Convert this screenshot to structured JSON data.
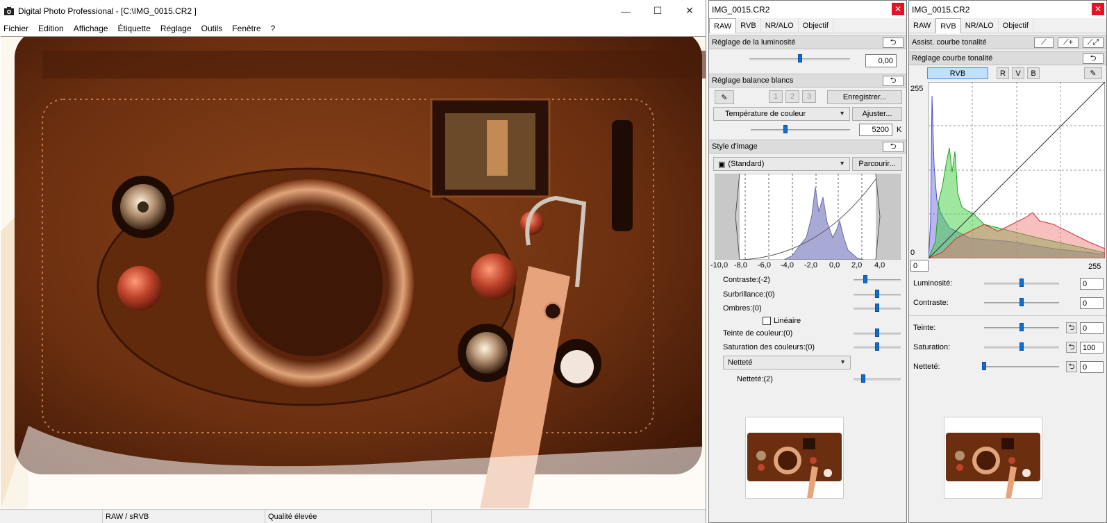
{
  "main": {
    "title": "Digital Photo Professional - [C:\\IMG_0015.CR2  ]",
    "menu": [
      "Fichier",
      "Edition",
      "Affichage",
      "Étiquette",
      "Réglage",
      "Outils",
      "Fenêtre",
      "?"
    ],
    "status": {
      "cell1": "",
      "cell2": "RAW / sRVB",
      "cell3": "Qualité élevée",
      "cell4": ""
    }
  },
  "left_panel": {
    "title": "IMG_0015.CR2",
    "tabs": [
      "RAW",
      "RVB",
      "NR/ALO",
      "Objectif"
    ],
    "active_tab": "RAW",
    "brightness": {
      "header": "Réglage de la luminosité",
      "value": "0,00",
      "slider_level": 0.5
    },
    "white_balance": {
      "header": "Réglage balance blancs",
      "presets": [
        "1",
        "2",
        "3"
      ],
      "register_label": "Enregistrer...",
      "mode": "Température de couleur",
      "adjust_label": "Ajuster...",
      "kelvin": "5200",
      "unit": "K",
      "slider_level": 0.35
    },
    "picture_style": {
      "header": "Style d'image",
      "style": "(Standard)",
      "browse_label": "Parcourir...",
      "axis_ticks": [
        "-10,0",
        "-8,0",
        "-6,0",
        "-4,0",
        "-2,0",
        "0,0",
        "2,0",
        "4,0"
      ],
      "contrast": {
        "label": "Contraste:(-2)",
        "level": 0.25
      },
      "highlight": {
        "label": "Surbrillance:(0)",
        "level": 0.5
      },
      "shadows": {
        "label": "Ombres:(0)",
        "level": 0.5
      },
      "linear_label": "Linéaire",
      "color_tone": {
        "label": "Teinte de couleur:(0)",
        "level": 0.5
      },
      "saturation": {
        "label": "Saturation des couleurs:(0)",
        "level": 0.5
      },
      "sharpness_mode": "Netteté",
      "sharpness": {
        "label": "Netteté:(2)",
        "level": 0.2
      }
    }
  },
  "right_panel": {
    "title": "IMG_0015.CR2",
    "tabs": [
      "RAW",
      "RVB",
      "NR/ALO",
      "Objectif"
    ],
    "active_tab": "RVB",
    "curve_assist_header": "Assist. courbe tonalité",
    "curve_adjust_header": "Réglage courbe tonalité",
    "channels": [
      "RVB",
      "R",
      "V",
      "B"
    ],
    "active_channel": "RVB",
    "axis": {
      "top": "255",
      "bottom_left": "0",
      "x_min": "0",
      "x_max": "255"
    },
    "brightness": {
      "label": "Luminosité:",
      "value": "0",
      "level": 0.5
    },
    "contrast": {
      "label": "Contraste:",
      "value": "0",
      "level": 0.5
    },
    "hue": {
      "label": "Teinte:",
      "value": "0",
      "level": 0.5
    },
    "saturation": {
      "label": "Saturation:",
      "value": "100",
      "level": 0.5
    },
    "sharpness": {
      "label": "Netteté:",
      "value": "0",
      "level": 0.0
    }
  },
  "colors": {
    "accent": "#0f6fd1",
    "close_red": "#e81123",
    "leather": "#7a3a14",
    "hist_blue": "#6b6bd6",
    "hist_green": "#2fbf2f",
    "hist_red": "#e25050"
  }
}
